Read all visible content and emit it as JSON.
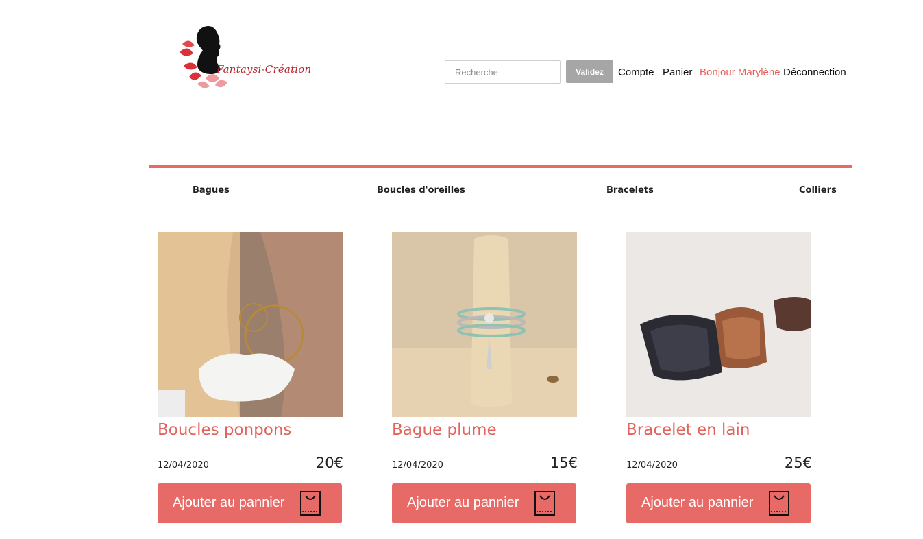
{
  "header": {
    "logo_text": "Fantaysi-Création",
    "search": {
      "placeholder": "Recherche",
      "value": ""
    },
    "validate_label": "Validez",
    "nav": {
      "account": "Compte",
      "cart": "Panier",
      "greeting": "Bonjour Marylène",
      "logout": "Déconnection"
    }
  },
  "categories": [
    "Bagues",
    "Boucles d'oreilles",
    "Bracelets",
    "Colliers"
  ],
  "products": [
    {
      "name": "Boucles ponpons",
      "date": "12/04/2020",
      "price": "20€",
      "button": "Ajouter au pannier"
    },
    {
      "name": "Bague plume",
      "date": "12/04/2020",
      "price": "15€",
      "button": "Ajouter au pannier"
    },
    {
      "name": "Bracelet en lain",
      "date": "12/04/2020",
      "price": "25€",
      "button": "Ajouter au pannier"
    }
  ],
  "colors": {
    "accent": "#e76a66",
    "accent_text": "#e2625c",
    "validate_button": "#a6a6a6"
  },
  "icons": {
    "logo": "woman-silhouette-logo",
    "cart_button": "shopping-bag-icon"
  }
}
